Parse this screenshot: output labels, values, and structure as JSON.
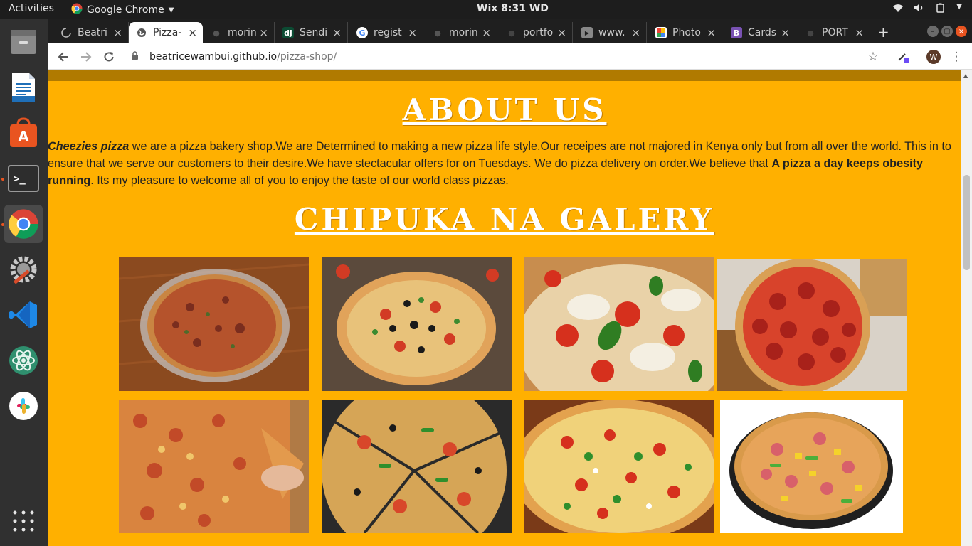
{
  "system_bar": {
    "activities": "Activities",
    "app_name": "Google Chrome",
    "clock": "Wix  8:31 WD"
  },
  "tabs": [
    {
      "label": "Beatri",
      "icon": "loading-icon",
      "active": false
    },
    {
      "label": "Pizza-",
      "icon": "globe-icon",
      "active": true
    },
    {
      "label": "morin",
      "icon": "github-icon",
      "active": false
    },
    {
      "label": "Sendi",
      "icon": "django-icon",
      "active": false
    },
    {
      "label": "regist",
      "icon": "google-icon",
      "active": false
    },
    {
      "label": "morin",
      "icon": "github-icon",
      "active": false
    },
    {
      "label": "portfo",
      "icon": "github-icon",
      "active": false
    },
    {
      "label": "www.",
      "icon": "youtube-icon",
      "active": false
    },
    {
      "label": "Photo",
      "icon": "photo-icon",
      "active": false
    },
    {
      "label": "Cards",
      "icon": "bootstrap-icon",
      "active": false
    },
    {
      "label": "PORT",
      "icon": "github-icon",
      "active": false
    }
  ],
  "address_bar": {
    "host": "beatricewambui.github.io",
    "path": "/pizza-shop/"
  },
  "profile_initial": "W",
  "page": {
    "about_title": "ABOUT US",
    "about_brand": "Cheezies pizza",
    "about_body_1": " we are a pizza bakery shop.We are Determined to making a new pizza life style.Our receipes are not majored in Kenya only but from all over the world. This in to ensure that we serve our customers to their desire.We have stectacular offers for on Tuesdays. We do pizza delivery on order.We believe that ",
    "about_motto": "A pizza a day keeps obesity running",
    "about_body_2": ". Its my pleasure to welcome all of you to enjoy the taste of our world class pizzas.",
    "gallery_title": "CHIPUKA NA GALERY"
  },
  "colors": {
    "page_background": "#ffb000",
    "nav_band": "#b07a00",
    "heading": "#ffffff"
  }
}
